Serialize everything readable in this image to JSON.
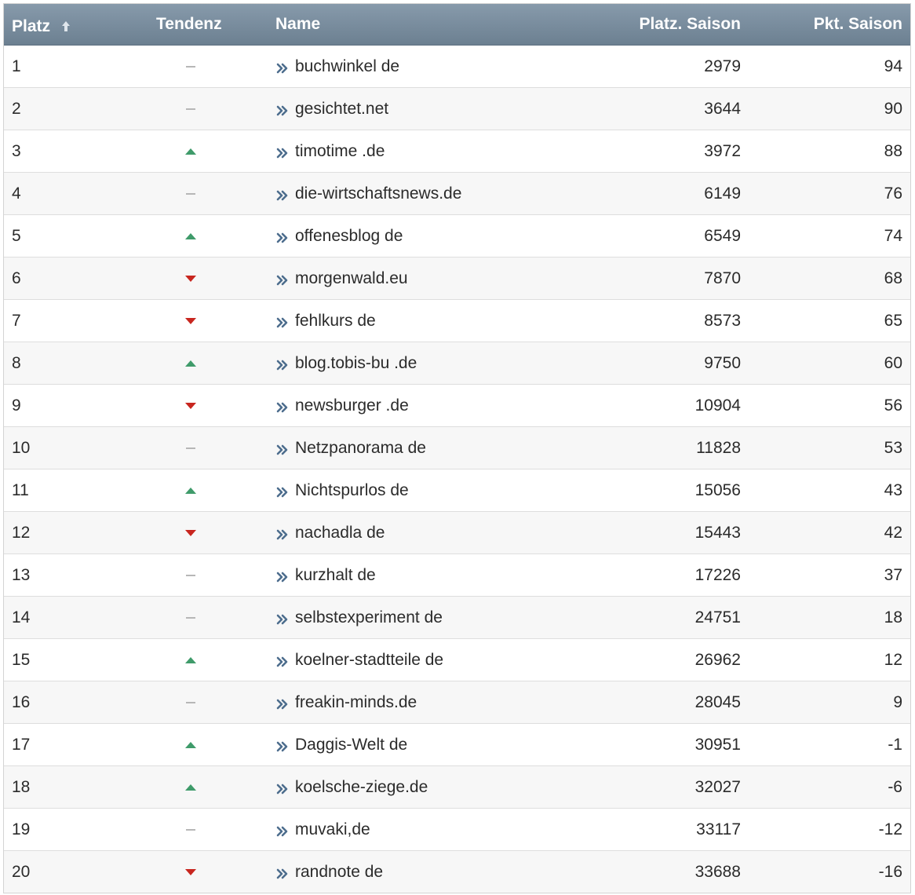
{
  "table": {
    "headers": {
      "rank": "Platz",
      "trend": "Tendenz",
      "name": "Name",
      "season_position": "Platz. Saison",
      "season_points": "Pkt. Saison"
    },
    "sort_indicator_icon": "sort-ascending-icon",
    "colors": {
      "header_bg": "#7a8ea0",
      "trend_up": "#3f9b6a",
      "trend_down": "#c8261f",
      "trend_flat": "#b7b7b7",
      "link_icon": "#4d6d8d"
    },
    "rows": [
      {
        "rank": "1",
        "trend": "flat",
        "name": "buchwinkel de",
        "season_position": "2979",
        "season_points": "94"
      },
      {
        "rank": "2",
        "trend": "flat",
        "name": "gesichtet.net",
        "season_position": "3644",
        "season_points": "90"
      },
      {
        "rank": "3",
        "trend": "up",
        "name": "timotime .de",
        "season_position": "3972",
        "season_points": "88"
      },
      {
        "rank": "4",
        "trend": "flat",
        "name": "die-wirtschaftsnews.de",
        "season_position": "6149",
        "season_points": "76"
      },
      {
        "rank": "5",
        "trend": "up",
        "name": "offenesblog de",
        "season_position": "6549",
        "season_points": "74"
      },
      {
        "rank": "6",
        "trend": "down",
        "name": "morgenwald.eu",
        "season_position": "7870",
        "season_points": "68"
      },
      {
        "rank": "7",
        "trend": "down",
        "name": "fehlkurs de",
        "season_position": "8573",
        "season_points": "65"
      },
      {
        "rank": "8",
        "trend": "up",
        "name": "blog.tobis-bu .de",
        "season_position": "9750",
        "season_points": "60"
      },
      {
        "rank": "9",
        "trend": "down",
        "name": "newsburger .de",
        "season_position": "10904",
        "season_points": "56"
      },
      {
        "rank": "10",
        "trend": "flat",
        "name": "Netzpanorama de",
        "season_position": "11828",
        "season_points": "53"
      },
      {
        "rank": "11",
        "trend": "up",
        "name": "Nichtspurlos de",
        "season_position": "15056",
        "season_points": "43"
      },
      {
        "rank": "12",
        "trend": "down",
        "name": "nachadla de",
        "season_position": "15443",
        "season_points": "42"
      },
      {
        "rank": "13",
        "trend": "flat",
        "name": "kurzhalt de",
        "season_position": "17226",
        "season_points": "37"
      },
      {
        "rank": "14",
        "trend": "flat",
        "name": "selbstexperiment de",
        "season_position": "24751",
        "season_points": "18"
      },
      {
        "rank": "15",
        "trend": "up",
        "name": "koelner-stadtteile de",
        "season_position": "26962",
        "season_points": "12"
      },
      {
        "rank": "16",
        "trend": "flat",
        "name": "freakin-minds.de",
        "season_position": "28045",
        "season_points": "9"
      },
      {
        "rank": "17",
        "trend": "up",
        "name": "Daggis-Welt de",
        "season_position": "30951",
        "season_points": "-1"
      },
      {
        "rank": "18",
        "trend": "up",
        "name": "koelsche-ziege.de",
        "season_position": "32027",
        "season_points": "-6"
      },
      {
        "rank": "19",
        "trend": "flat",
        "name": "muvaki,de",
        "season_position": "33117",
        "season_points": "-12"
      },
      {
        "rank": "20",
        "trend": "down",
        "name": "randnote de",
        "season_position": "33688",
        "season_points": "-16"
      }
    ]
  }
}
